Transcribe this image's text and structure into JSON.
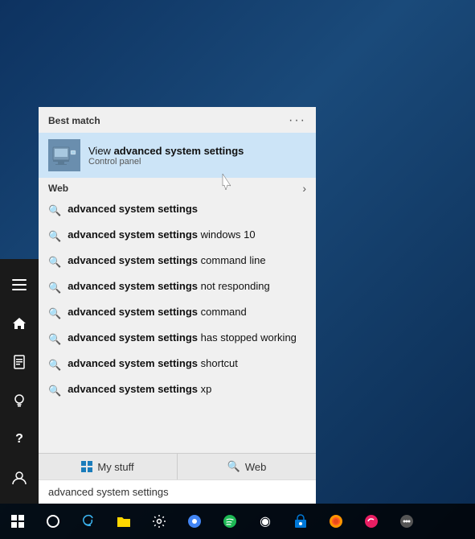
{
  "desktop": {
    "bg_color": "#1a3a5c"
  },
  "sidebar": {
    "icons": [
      {
        "name": "hamburger-icon",
        "symbol": "☰"
      },
      {
        "name": "home-icon",
        "symbol": "⊞"
      },
      {
        "name": "person-icon",
        "symbol": "👤"
      },
      {
        "name": "lightbulb-icon",
        "symbol": "💡"
      },
      {
        "name": "question-icon",
        "symbol": "?"
      },
      {
        "name": "user-circle-icon",
        "symbol": "👤"
      }
    ]
  },
  "best_match": {
    "header": "Best match",
    "dots": "···",
    "item_name_bold": "View ",
    "item_name_rest": "advanced system settings",
    "item_sub": "Control panel"
  },
  "web_section": {
    "label": "Web",
    "arrow": "›"
  },
  "results": [
    {
      "bold": "advanced system settings",
      "suffix": ""
    },
    {
      "bold": "advanced system settings",
      "suffix": " windows 10"
    },
    {
      "bold": "advanced system settings",
      "suffix": " command line"
    },
    {
      "bold": "advanced system settings",
      "suffix": " not responding"
    },
    {
      "bold": "advanced system settings",
      "suffix": " command"
    },
    {
      "bold": "advanced system settings",
      "suffix": " has stopped working",
      "wrap": true
    },
    {
      "bold": "advanced system settings",
      "suffix": " shortcut"
    },
    {
      "bold": "advanced system settings",
      "suffix": " xp"
    }
  ],
  "bottom_tabs": [
    {
      "icon": "windows-icon",
      "label": "My stuff"
    },
    {
      "icon": "search-icon",
      "label": "Web"
    }
  ],
  "search_input": {
    "value": "advanced system settings"
  },
  "taskbar": {
    "icons": [
      "⊞",
      "○",
      "e",
      "📁",
      "⚙",
      "🌐",
      "♪",
      "◉",
      "🛍",
      "🦊",
      "🐟",
      "⚙"
    ]
  }
}
